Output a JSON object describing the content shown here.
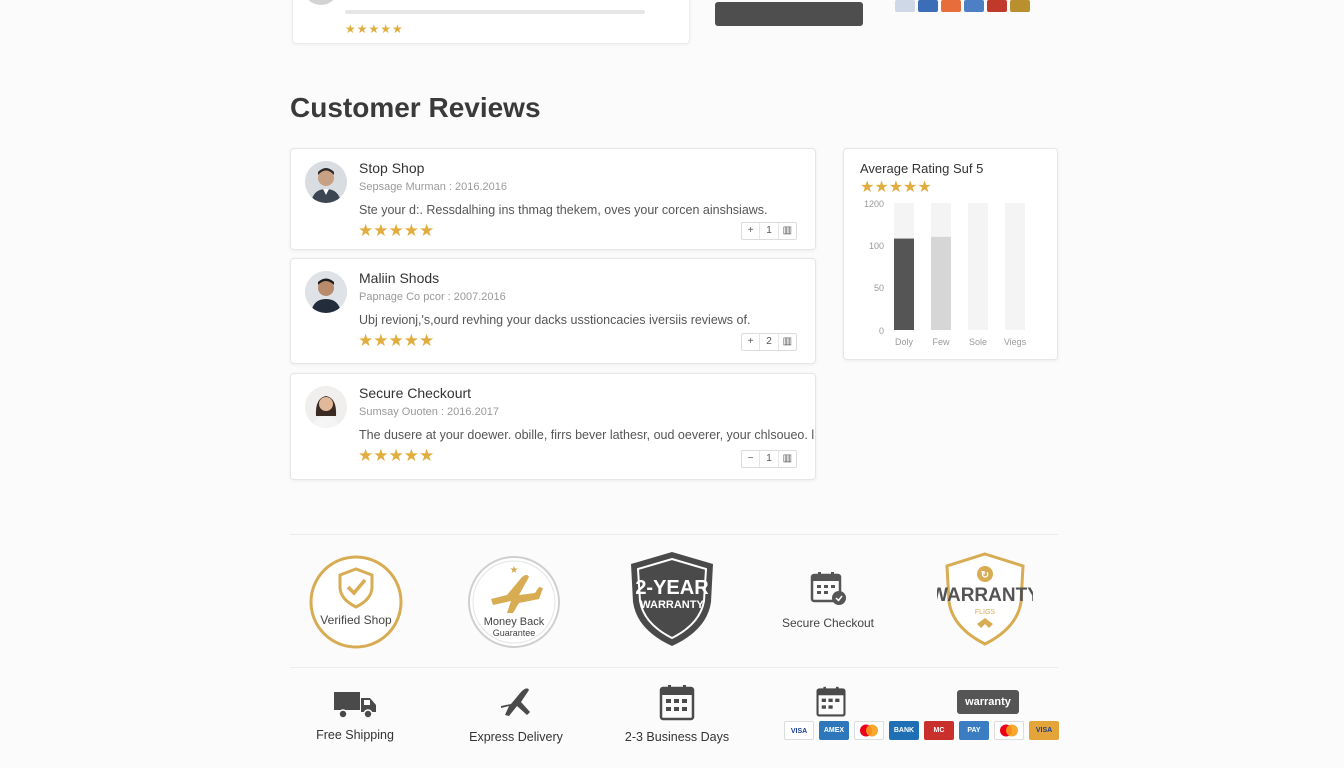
{
  "section_title": "Customer Reviews",
  "reviews": [
    {
      "name": "Stop Shop",
      "meta": "Sepsage Murman : 2016.2016",
      "text": "Ste your d:. Ressdalhing ins thmag thekem, oves your corcen ainshsiaws.",
      "stars": "★★★★★",
      "stepper": {
        "minus": "+",
        "value": "1",
        "icon": "trash-icon"
      }
    },
    {
      "name": "Maliin Shods",
      "meta": "Papnage Co pcor : 2007.2016",
      "text": "Ubj revionj,'s,ourd revhing your dacks usstioncacies iversiis reviews of.",
      "stars": "★★★★★",
      "stepper": {
        "minus": "+",
        "value": "2",
        "icon": "trash-icon"
      }
    },
    {
      "name": "Secure Checkourt",
      "meta": "Sumsay Ouoten : 2016.2017",
      "text": "The dusere at your doewer. obille, firrs bever lathesr, oud oeverer, your chlsoueo. l",
      "stars": "★★★★★",
      "stepper": {
        "minus": "−",
        "value": "1",
        "icon": "trash-icon"
      }
    }
  ],
  "rating_card": {
    "title": "Average Rating Suf 5",
    "stars": "★★★★★"
  },
  "chart_data": {
    "type": "bar",
    "categories": [
      "Doly",
      "Few",
      "Sole",
      "Viegs"
    ],
    "y_tick_labels": [
      "1200",
      "100",
      "50",
      "0"
    ],
    "values": [
      108,
      110,
      0,
      0
    ],
    "ylim": [
      0,
      150
    ],
    "colors": [
      "#555555",
      "#d6d6d6",
      "#f2f2f2",
      "#f2f2f2"
    ]
  },
  "badges": {
    "verified": "Verified Shop",
    "money_back_1": "Money Back",
    "money_back_2": "Guarantee",
    "two_year_1": "2-YEAR",
    "two_year_2": "WARRANTY",
    "secure_checkout": "Secure Checkout",
    "warranty": "WARRANTY",
    "warranty_sub": "FLIGS"
  },
  "features": {
    "free_shipping": "Free Shipping",
    "express_delivery": "Express Delivery",
    "business_days": "2-3 Business Days",
    "warranty_tag": "warranty"
  },
  "payments": [
    "VISA",
    "AMEX",
    "MC",
    "BANK",
    "MC",
    "PAY",
    "MC",
    "VISA"
  ],
  "colors": {
    "gold": "#e0ad3e",
    "dark": "#555555"
  }
}
